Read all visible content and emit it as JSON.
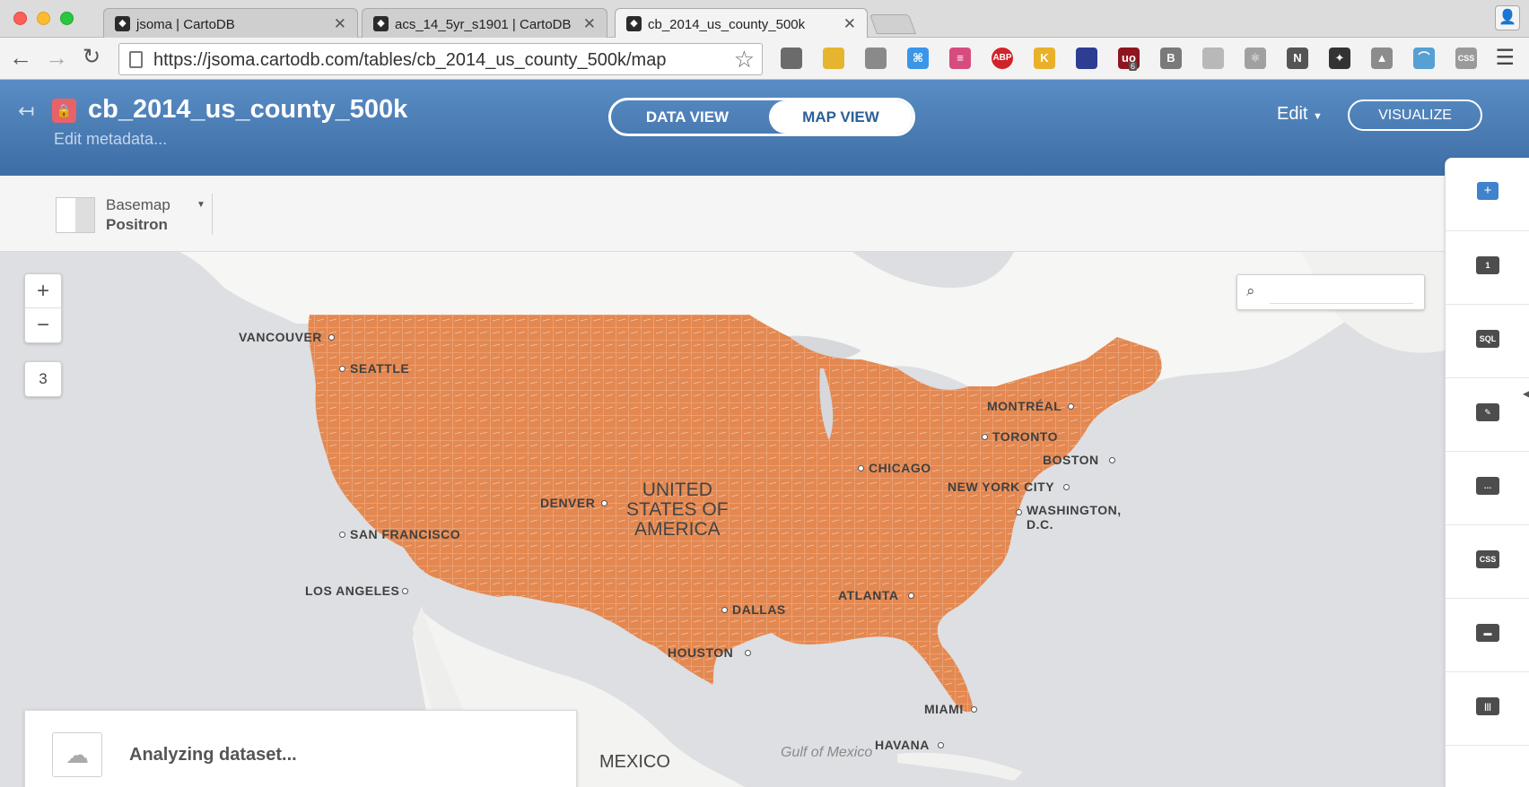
{
  "browser": {
    "tabs": [
      {
        "title": "jsoma | CartoDB",
        "active": false
      },
      {
        "title": "acs_14_5yr_s1901 | CartoDB",
        "active": false
      },
      {
        "title": "cb_2014_us_county_500k",
        "active": true
      }
    ],
    "url": "https://jsoma.cartodb.com/tables/cb_2014_us_county_500k/map",
    "extensions": [
      {
        "name": "cast-icon",
        "label": "",
        "color": "#6b6b6b"
      },
      {
        "name": "extension-yellow-icon",
        "label": "",
        "color": "#e6b530"
      },
      {
        "name": "extension-plane-icon",
        "label": "",
        "color": "#8a8a8a"
      },
      {
        "name": "extension-blue-icon",
        "label": "⌘",
        "color": "#3b96e8"
      },
      {
        "name": "extension-list-icon",
        "label": "≡",
        "color": "#d74c7f"
      },
      {
        "name": "adblock-icon",
        "label": "ABP",
        "color": "#d0232a"
      },
      {
        "name": "extension-k-icon",
        "label": "K",
        "color": "#e9b12a"
      },
      {
        "name": "extension-globe-icon",
        "label": "",
        "color": "#2c3d92"
      },
      {
        "name": "ublock-icon",
        "label": "uo",
        "color": "#8e1620"
      },
      {
        "name": "extension-b-icon",
        "label": "B",
        "color": "#7a7a7a"
      },
      {
        "name": "extension-swirl-icon",
        "label": "",
        "color": "#b8b8b8"
      },
      {
        "name": "extension-atom-icon",
        "label": "⚛",
        "color": "#a0a0a0"
      },
      {
        "name": "extension-n-icon",
        "label": "N",
        "color": "#555555"
      },
      {
        "name": "extension-compass-icon",
        "label": "✦",
        "color": "#333333"
      },
      {
        "name": "drive-icon",
        "label": "▲",
        "color": "#8c8c8c"
      },
      {
        "name": "extension-rainbow-icon",
        "label": "⌒",
        "color": "#56a0d3"
      },
      {
        "name": "extension-css-icon",
        "label": "CSS",
        "color": "#9a9a9a"
      }
    ],
    "ublock_badge": "6"
  },
  "header": {
    "table_name": "cb_2014_us_county_500k",
    "edit_metadata": "Edit metadata...",
    "view_switch": {
      "data": "DATA VIEW",
      "map": "MAP VIEW"
    },
    "edit_dropdown": "Edit",
    "visualize": "VISUALIZE",
    "accent": "#4a7cb7"
  },
  "basemap": {
    "label": "Basemap",
    "value": "Positron"
  },
  "map": {
    "zoom_in": "+",
    "zoom_out": "−",
    "zoom_level": "3",
    "fill_color": "#e48851",
    "country_label": "UNITED STATES OF AMERICA",
    "country_lines": [
      "UNITED",
      "STATES OF",
      "AMERICA"
    ],
    "cities": [
      {
        "name": "VANCOUVER"
      },
      {
        "name": "SEATTLE"
      },
      {
        "name": "SAN FRANCISCO"
      },
      {
        "name": "LOS ANGELES"
      },
      {
        "name": "DENVER"
      },
      {
        "name": "DALLAS"
      },
      {
        "name": "HOUSTON"
      },
      {
        "name": "CHICAGO"
      },
      {
        "name": "ATLANTA"
      },
      {
        "name": "MIAMI"
      },
      {
        "name": "TORONTO"
      },
      {
        "name": "MONTRÉAL"
      },
      {
        "name": "BOSTON"
      },
      {
        "name": "NEW YORK CITY"
      },
      {
        "name": "WASHINGTON,"
      },
      {
        "name": "D.C."
      },
      {
        "name": "HAVANA"
      }
    ],
    "mexico": "MEXICO",
    "gulf": "Gulf of Mexico"
  },
  "status": {
    "analyzing": "Analyzing dataset..."
  },
  "right_panel": [
    {
      "name": "add-layer-icon",
      "label": "+"
    },
    {
      "name": "layer-1-icon",
      "label": "1"
    },
    {
      "name": "sql-icon",
      "label": "SQL"
    },
    {
      "name": "wizard-icon",
      "label": "✎"
    },
    {
      "name": "infowindow-icon",
      "label": "…"
    },
    {
      "name": "css-icon",
      "label": "CSS"
    },
    {
      "name": "legend-icon",
      "label": "▬"
    },
    {
      "name": "filters-icon",
      "label": "|||"
    }
  ]
}
